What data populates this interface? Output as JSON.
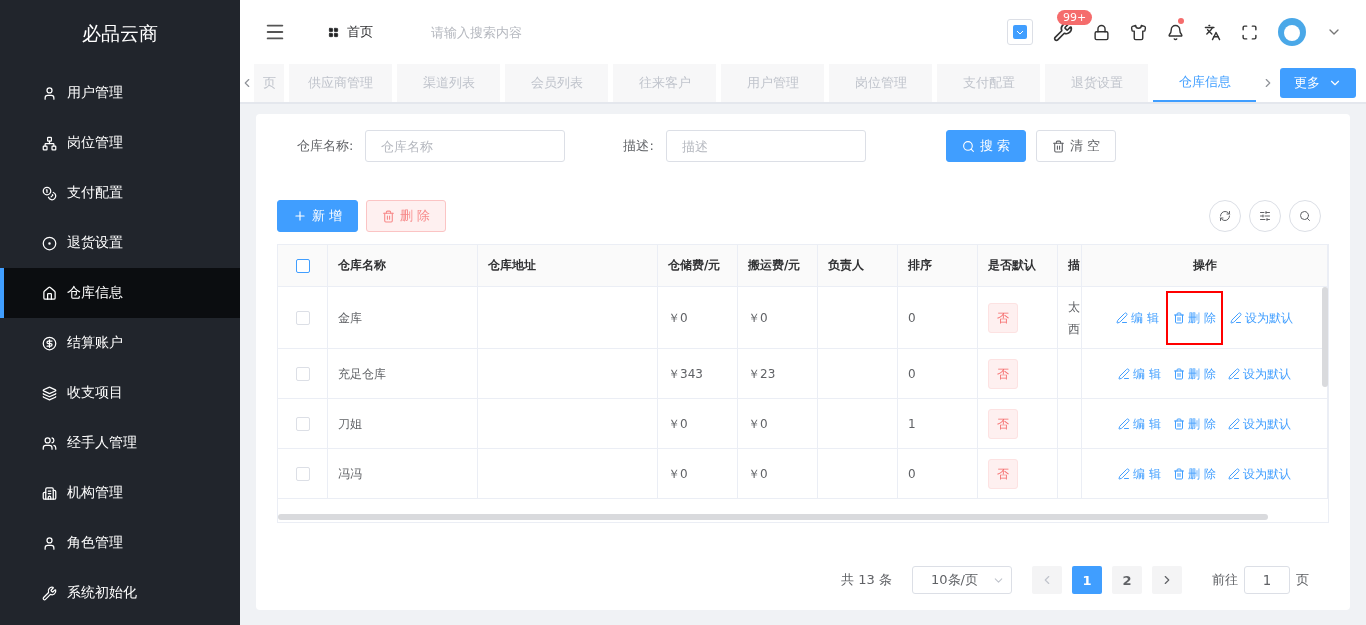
{
  "sidebar": {
    "brand": "必品云商",
    "items": [
      {
        "label": "用户管理",
        "selected": false
      },
      {
        "label": "岗位管理",
        "selected": false
      },
      {
        "label": "支付配置",
        "selected": false
      },
      {
        "label": "退货设置",
        "selected": false
      },
      {
        "label": "仓库信息",
        "selected": true
      },
      {
        "label": "结算账户",
        "selected": false
      },
      {
        "label": "收支项目",
        "selected": false
      },
      {
        "label": "经手人管理",
        "selected": false
      },
      {
        "label": "机构管理",
        "selected": false
      },
      {
        "label": "角色管理",
        "selected": false
      },
      {
        "label": "系统初始化",
        "selected": false
      }
    ]
  },
  "header": {
    "breadcrumb": "首页",
    "search_placeholder": "请输入搜索内容",
    "badge": "99+",
    "notification_dot": true
  },
  "tabs": {
    "items": [
      {
        "label": "页",
        "selected": false
      },
      {
        "label": "供应商管理",
        "selected": false
      },
      {
        "label": "渠道列表",
        "selected": false
      },
      {
        "label": "会员列表",
        "selected": false
      },
      {
        "label": "往来客户",
        "selected": false
      },
      {
        "label": "用户管理",
        "selected": false
      },
      {
        "label": "岗位管理",
        "selected": false
      },
      {
        "label": "支付配置",
        "selected": false
      },
      {
        "label": "退货设置",
        "selected": false
      },
      {
        "label": "仓库信息",
        "selected": true
      }
    ],
    "more": "更多"
  },
  "filters": [
    {
      "label": "仓库名称:",
      "placeholder": "仓库名称"
    },
    {
      "label": "描述:",
      "placeholder": "描述"
    }
  ],
  "search_button": "搜 索",
  "clear_button": "清 空",
  "add_button": "新 增",
  "delete_button": "删 除",
  "table": {
    "select_all_checked": false,
    "columns": [
      "仓库名称",
      "仓库地址",
      "仓储费/元",
      "搬运费/元",
      "负责人",
      "排序",
      "是否默认",
      "描",
      "操作"
    ],
    "rows": [
      {
        "checked": false,
        "name": "金库",
        "storage_fee": "￥0",
        "handling_fee": "￥0",
        "sort": "0",
        "default": "否",
        "description": [
          "太",
          "西"
        ],
        "actions": [
          {
            "label": "编 辑",
            "kind": "edit",
            "highlighted": false
          },
          {
            "label": "删 除",
            "kind": "delete",
            "highlighted": true
          },
          {
            "label": "设为默认",
            "kind": "edit",
            "highlighted": false
          }
        ]
      },
      {
        "checked": false,
        "name": "充足仓库",
        "storage_fee": "￥343",
        "handling_fee": "￥23",
        "sort": "0",
        "default": "否",
        "actions": [
          {
            "label": "编 辑",
            "kind": "edit",
            "highlighted": false
          },
          {
            "label": "删 除",
            "kind": "delete",
            "highlighted": false
          },
          {
            "label": "设为默认",
            "kind": "edit",
            "highlighted": false
          }
        ]
      },
      {
        "checked": false,
        "name": "刀姐",
        "storage_fee": "￥0",
        "handling_fee": "￥0",
        "sort": "1",
        "default": "否",
        "actions": [
          {
            "label": "编 辑",
            "kind": "edit",
            "highlighted": false
          },
          {
            "label": "删 除",
            "kind": "delete",
            "highlighted": false
          },
          {
            "label": "设为默认",
            "kind": "edit",
            "highlighted": false
          }
        ]
      },
      {
        "checked": false,
        "name": "冯冯",
        "storage_fee": "￥0",
        "handling_fee": "￥0",
        "sort": "0",
        "default": "否",
        "actions": [
          {
            "label": "编 辑",
            "kind": "edit",
            "highlighted": false
          },
          {
            "label": "删 除",
            "kind": "delete",
            "highlighted": false
          },
          {
            "label": "设为默认",
            "kind": "edit",
            "highlighted": false
          }
        ]
      }
    ]
  },
  "pagination": {
    "total": "共 13 条",
    "page_size": "10条/页",
    "pages": [
      {
        "label": "1",
        "selected": true
      },
      {
        "label": "2",
        "selected": false
      }
    ],
    "goto_label": "前往",
    "goto_value": "1",
    "goto_suffix": "页"
  }
}
